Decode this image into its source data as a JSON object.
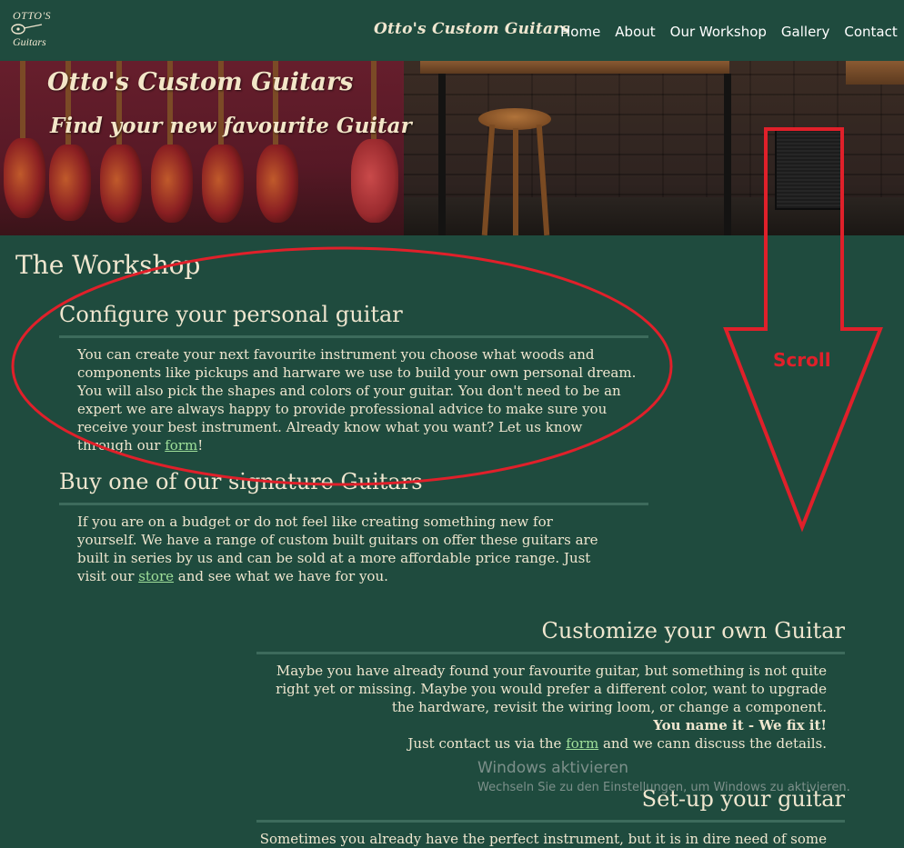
{
  "header": {
    "logo": {
      "line1": "OTTO'S",
      "line2": "Guitars"
    },
    "brand": "Otto's Custom Guitars",
    "nav": [
      "Home",
      "About",
      "Our Workshop",
      "Gallery",
      "Contact"
    ]
  },
  "hero": {
    "title": "Otto's Custom Guitars",
    "subtitle": "Find your new favourite Guitar"
  },
  "main": {
    "page_title": "The Workshop",
    "sections": [
      {
        "heading": "Configure your personal guitar",
        "text_before": "You can create your next favourite instrument you choose what woods and components like pickups and harware we use to build your own personal dream. You will also pick the shapes and colors of your guitar. You don't need to be an expert we are always happy to provide professional advice to make sure you receive your best instrument. Already know what you want? Let us know through our ",
        "link": "form",
        "text_after": "!"
      },
      {
        "heading": "Buy one of our signature Guitars",
        "text_before": "If you are on a budget or do not feel like creating something new for yourself. We have a range of custom built guitars on offer these guitars are built in series by us and can be sold at a more affordable price range. Just visit our ",
        "link": "store",
        "text_after": " and see what we have for you."
      },
      {
        "heading": "Customize your own Guitar",
        "text": "Maybe you have already found your favourite guitar, but something is not quite right yet or missing. Maybe you would prefer a different color, want to upgrade the hardware, revisit the wiring loom, or change a component.",
        "bold": "You name it - We fix it!",
        "text2_before": "Just contact us via the ",
        "link": "form",
        "text2_after": " and we cann discuss the details."
      },
      {
        "heading": "Set-up your guitar",
        "text": "Sometimes you already have the perfect instrument, but it is in dire need of some"
      }
    ]
  },
  "annotation": {
    "label": "Scroll",
    "color": "#e0202a"
  },
  "watermark": {
    "title": "Windows aktivieren",
    "subtitle": "Wechseln Sie zu den Einstellungen, um Windows zu aktivieren."
  },
  "colors": {
    "background": "#1f4b3e",
    "text": "#efe6cf",
    "link": "#9fe09a",
    "rule": "#3d6b5c"
  }
}
